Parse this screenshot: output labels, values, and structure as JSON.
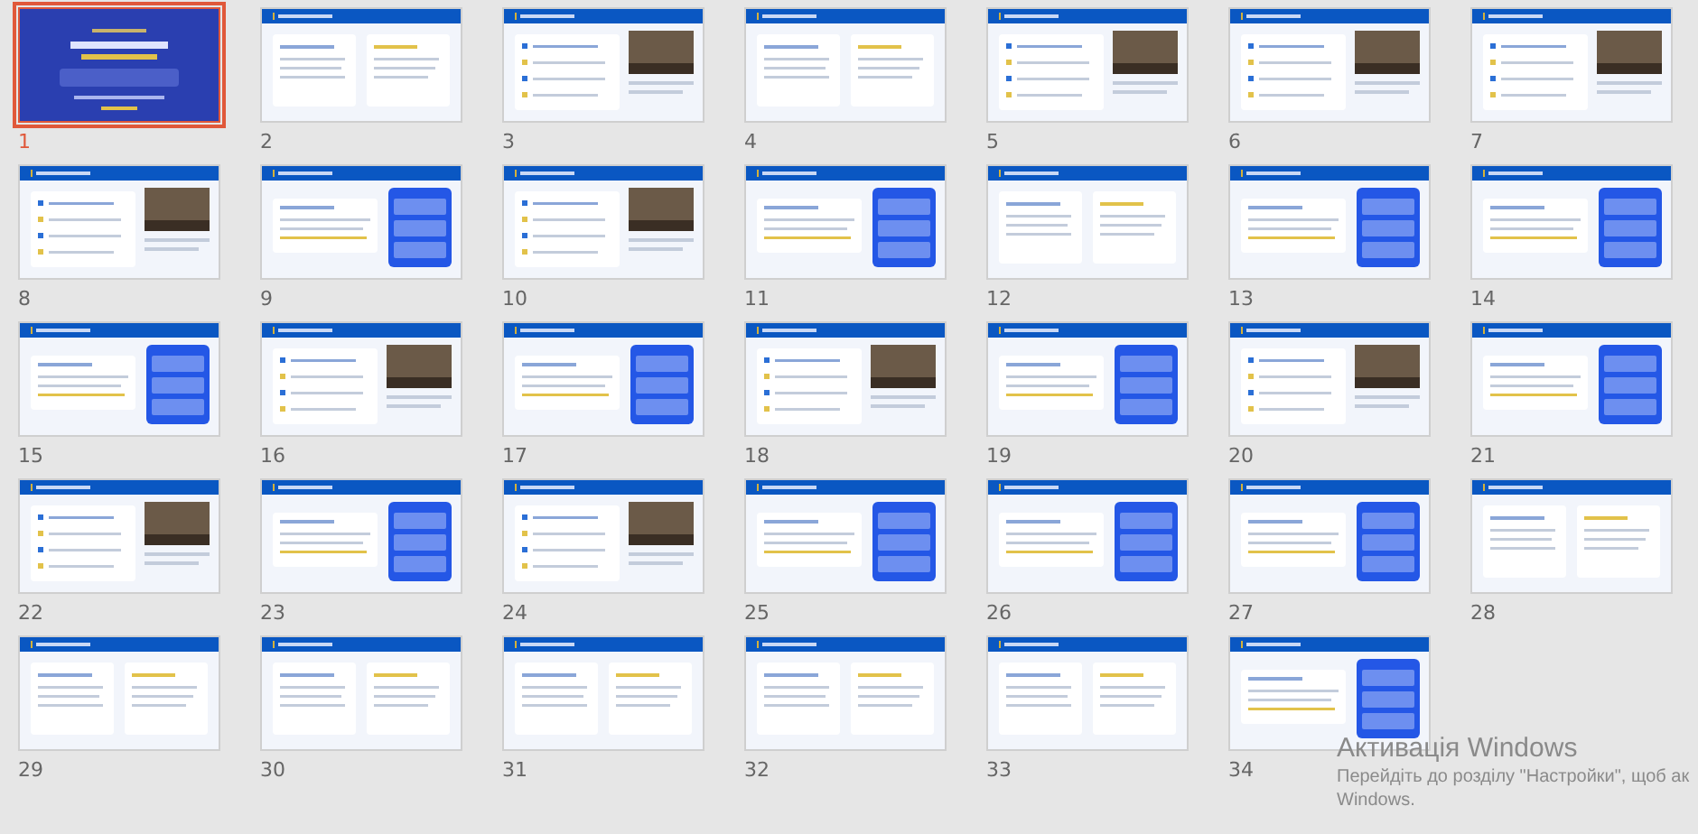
{
  "slides": [
    {
      "number": "1",
      "kind": "title",
      "selected": true
    },
    {
      "number": "2",
      "kind": "content",
      "selected": false
    },
    {
      "number": "3",
      "kind": "photo",
      "selected": false
    },
    {
      "number": "4",
      "kind": "content",
      "selected": false
    },
    {
      "number": "5",
      "kind": "photo",
      "selected": false
    },
    {
      "number": "6",
      "kind": "photo",
      "selected": false
    },
    {
      "number": "7",
      "kind": "photo",
      "selected": false
    },
    {
      "number": "8",
      "kind": "photo",
      "selected": false
    },
    {
      "number": "9",
      "kind": "panel",
      "selected": false
    },
    {
      "number": "10",
      "kind": "photo",
      "selected": false
    },
    {
      "number": "11",
      "kind": "panel",
      "selected": false
    },
    {
      "number": "12",
      "kind": "content",
      "selected": false
    },
    {
      "number": "13",
      "kind": "panel",
      "selected": false
    },
    {
      "number": "14",
      "kind": "panel",
      "selected": false
    },
    {
      "number": "15",
      "kind": "panel",
      "selected": false
    },
    {
      "number": "16",
      "kind": "photo",
      "selected": false
    },
    {
      "number": "17",
      "kind": "panel",
      "selected": false
    },
    {
      "number": "18",
      "kind": "photo",
      "selected": false
    },
    {
      "number": "19",
      "kind": "panel",
      "selected": false
    },
    {
      "number": "20",
      "kind": "photo",
      "selected": false
    },
    {
      "number": "21",
      "kind": "panel",
      "selected": false
    },
    {
      "number": "22",
      "kind": "photo",
      "selected": false
    },
    {
      "number": "23",
      "kind": "panel",
      "selected": false
    },
    {
      "number": "24",
      "kind": "photo",
      "selected": false
    },
    {
      "number": "25",
      "kind": "panel",
      "selected": false
    },
    {
      "number": "26",
      "kind": "panel",
      "selected": false
    },
    {
      "number": "27",
      "kind": "panel",
      "selected": false
    },
    {
      "number": "28",
      "kind": "content",
      "selected": false
    },
    {
      "number": "29",
      "kind": "content",
      "selected": false
    },
    {
      "number": "30",
      "kind": "content",
      "selected": false
    },
    {
      "number": "31",
      "kind": "content",
      "selected": false
    },
    {
      "number": "32",
      "kind": "content",
      "selected": false
    },
    {
      "number": "33",
      "kind": "content",
      "selected": false
    },
    {
      "number": "34",
      "kind": "panel",
      "selected": false
    }
  ],
  "activation_notice": {
    "title": "Активація Windows",
    "message": "Перейдіть до розділу \"Настройки\", щоб ак",
    "message_end": "Windows."
  }
}
